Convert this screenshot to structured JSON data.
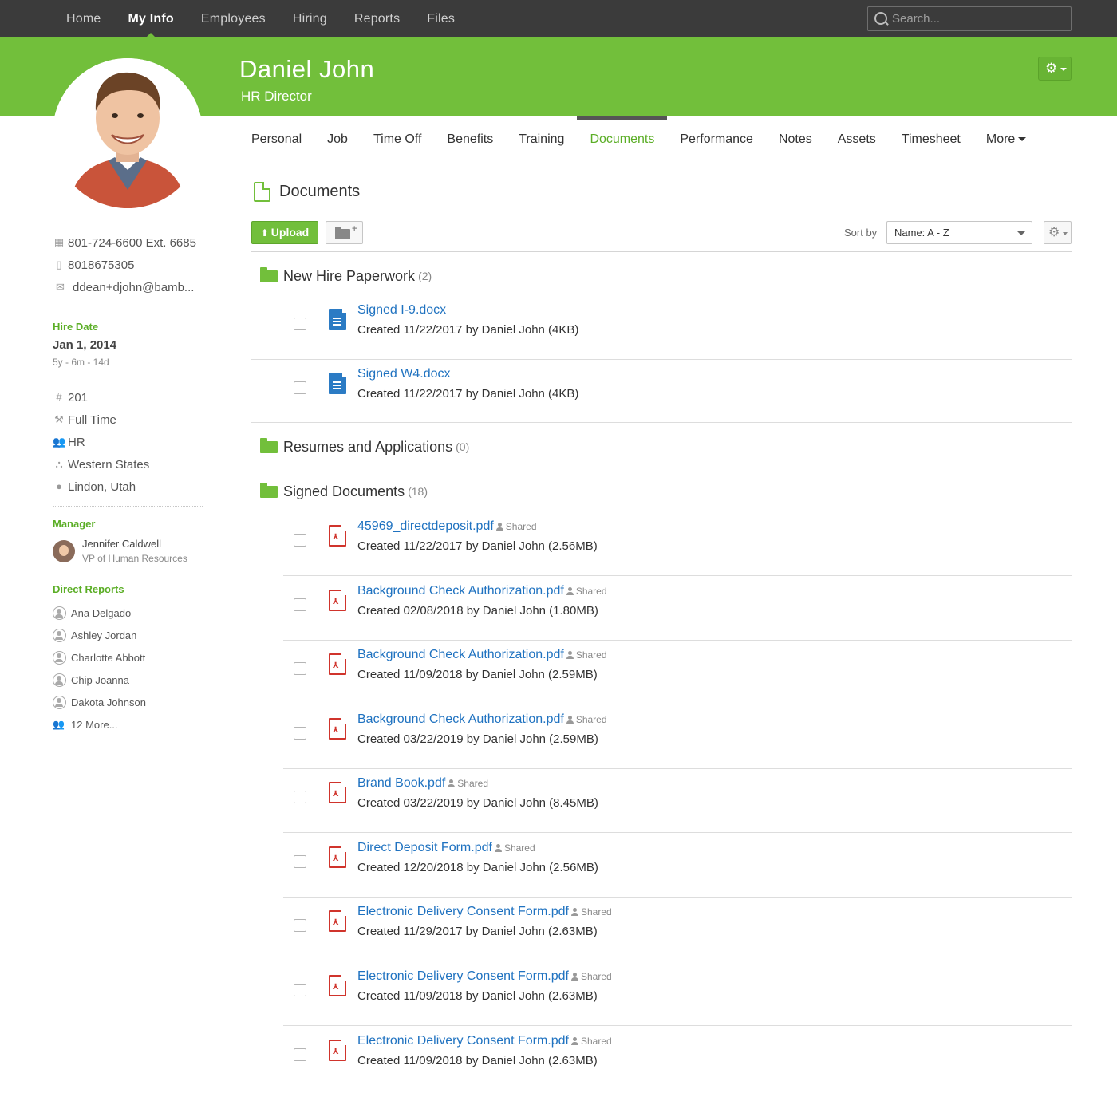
{
  "topnav": {
    "links": [
      "Home",
      "My Info",
      "Employees",
      "Hiring",
      "Reports",
      "Files"
    ],
    "active": "My Info",
    "search_placeholder": "Search..."
  },
  "header": {
    "name": "Daniel John",
    "title": "HR Director",
    "gear_icon": "gear-icon"
  },
  "tabs": [
    "Personal",
    "Job",
    "Time Off",
    "Benefits",
    "Training",
    "Documents",
    "Performance",
    "Notes",
    "Assets",
    "Timesheet",
    "More"
  ],
  "active_tab": "Documents",
  "sidebar": {
    "work_phone": "801-724-6600 Ext. 6685",
    "mobile_phone": "8018675305",
    "email": "ddean+djohn@bamb...",
    "hire_date_label": "Hire Date",
    "hire_date": "Jan 1, 2014",
    "tenure": "5y - 6m - 14d",
    "employee_number": "201",
    "employment_status": "Full Time",
    "department": "HR",
    "division": "Western States",
    "location": "Lindon, Utah",
    "manager_label": "Manager",
    "manager_name": "Jennifer Caldwell",
    "manager_title": "VP of Human Resources",
    "direct_reports_label": "Direct Reports",
    "direct_reports": [
      "Ana Delgado",
      "Ashley Jordan",
      "Charlotte Abbott",
      "Chip Joanna",
      "Dakota Johnson"
    ],
    "more_reports": "12 More..."
  },
  "documents": {
    "title": "Documents",
    "upload_label": "Upload",
    "sort_by_label": "Sort by",
    "sort_value": "Name: A - Z",
    "sections": [
      {
        "name": "New Hire Paperwork",
        "count": "(2)",
        "files": [
          {
            "name": "Signed I-9.docx",
            "meta": "Created 11/22/2017 by Daniel John (4KB)",
            "type": "doc",
            "shared": ""
          },
          {
            "name": "Signed W4.docx",
            "meta": "Created 11/22/2017 by Daniel John (4KB)",
            "type": "doc",
            "shared": ""
          }
        ]
      },
      {
        "name": "Resumes and Applications",
        "count": "(0)",
        "files": []
      },
      {
        "name": "Signed Documents",
        "count": "(18)",
        "files": [
          {
            "name": "45969_directdeposit.pdf",
            "meta": "Created 11/22/2017 by Daniel John (2.56MB)",
            "type": "pdf",
            "shared": "Shared"
          },
          {
            "name": "Background Check Authorization.pdf",
            "meta": "Created 02/08/2018 by Daniel John (1.80MB)",
            "type": "pdf",
            "shared": "Shared"
          },
          {
            "name": "Background Check Authorization.pdf",
            "meta": "Created 11/09/2018 by Daniel John (2.59MB)",
            "type": "pdf",
            "shared": "Shared"
          },
          {
            "name": "Background Check Authorization.pdf",
            "meta": "Created 03/22/2019 by Daniel John (2.59MB)",
            "type": "pdf",
            "shared": "Shared"
          },
          {
            "name": "Brand Book.pdf",
            "meta": "Created 03/22/2019 by Daniel John (8.45MB)",
            "type": "pdf",
            "shared": "Shared"
          },
          {
            "name": "Direct Deposit Form.pdf",
            "meta": "Created 12/20/2018 by Daniel John (2.56MB)",
            "type": "pdf",
            "shared": "Shared"
          },
          {
            "name": "Electronic Delivery Consent Form.pdf",
            "meta": "Created 11/29/2017 by Daniel John (2.63MB)",
            "type": "pdf",
            "shared": "Shared"
          },
          {
            "name": "Electronic Delivery Consent Form.pdf",
            "meta": "Created 11/09/2018 by Daniel John (2.63MB)",
            "type": "pdf",
            "shared": "Shared"
          },
          {
            "name": "Electronic Delivery Consent Form.pdf",
            "meta": "Created 11/09/2018 by Daniel John (2.63MB)",
            "type": "pdf",
            "shared": "Shared"
          }
        ]
      }
    ]
  },
  "colors": {
    "brand_green": "#72bf3b",
    "topbar": "#3b3b3b",
    "link_blue": "#1f72c0",
    "pdf_red": "#d0342c",
    "doc_blue": "#2b7bc4"
  }
}
